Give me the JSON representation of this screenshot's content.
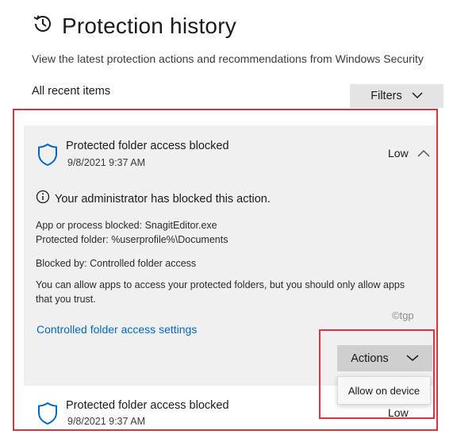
{
  "page": {
    "title": "Protection history",
    "subtitle": "View the latest protection actions and recommendations from Windows Security",
    "recent_label": "All recent items",
    "filters_label": "Filters"
  },
  "items": [
    {
      "title": "Protected folder access blocked",
      "date": "9/8/2021 9:37 AM",
      "severity": "Low",
      "expanded": true,
      "admin_message": "Your administrator has blocked this action.",
      "app_line": "App or process blocked:  SnagitEditor.exe",
      "folder_line": "Protected folder:  %userprofile%\\Documents",
      "blocked_by_line": "Blocked by:  Controlled folder access",
      "info_line1": "You can allow apps to access your protected folders, but you should only allow apps",
      "info_line2": "that you trust.",
      "settings_link": "Controlled folder access settings",
      "actions_label": "Actions",
      "menu_item": "Allow on device"
    },
    {
      "title": "Protected folder access blocked",
      "date": "9/8/2021 9:37 AM",
      "severity": "Low",
      "expanded": false
    }
  ],
  "watermark": "©tgp",
  "icons": {
    "history": "history-icon",
    "shield": "shield-icon",
    "info": "info-icon",
    "chevron_down": "chevron-down-icon",
    "chevron_up": "chevron-up-icon"
  },
  "colors": {
    "accent_link": "#0067c0",
    "shield_blue": "#0067c0",
    "highlight_red": "#e0323c",
    "card_bg": "#f0f0f0",
    "button_bg": "#e4e4e4"
  }
}
